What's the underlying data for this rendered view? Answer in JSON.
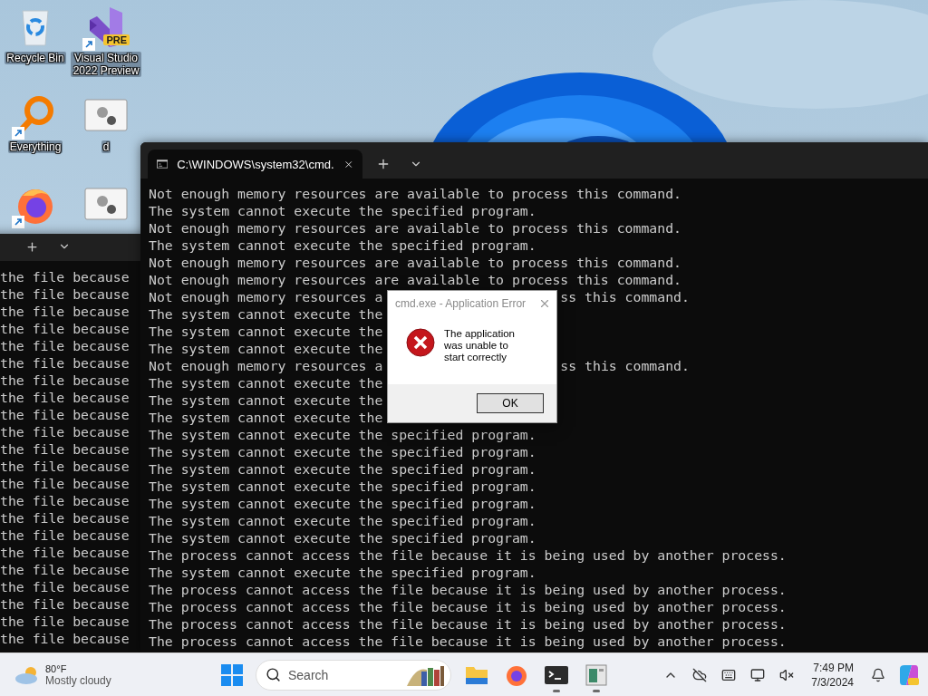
{
  "desktop_icons": [
    {
      "kind": "recycle-bin",
      "label": "Recycle Bin",
      "shortcut": false
    },
    {
      "kind": "everything",
      "label": "Everything",
      "shortcut": true
    },
    {
      "kind": "firefox",
      "shortcut": true
    },
    {
      "kind": "visual-studio",
      "label": "Visual Studio 2022 Preview",
      "badge": "PRE",
      "shortcut": true
    },
    {
      "kind": "settings-app",
      "label": "d",
      "shortcut": false
    },
    {
      "kind": "settings-app",
      "shortcut": false
    }
  ],
  "back_terminal": {
    "lines": [
      "the file because",
      "the file because",
      "the file because",
      "the file because",
      "the file because",
      "the file because",
      "the file because",
      "the file because",
      "the file because",
      "the file because",
      "the file because",
      "the file because",
      "the file because",
      "the file because",
      "the file because",
      "the file because",
      "the file because",
      "the file because",
      "the file because",
      "the file because",
      "the file because",
      "the file because"
    ]
  },
  "front_terminal": {
    "tab": {
      "title": "C:\\WINDOWS\\system32\\cmd.",
      "selected": true
    },
    "lines": [
      {
        "kind": "full",
        "text": "Not enough memory resources are available to process this command."
      },
      {
        "kind": "full",
        "text": "The system cannot execute the specified program."
      },
      {
        "kind": "full",
        "text": "Not enough memory resources are available to process this command."
      },
      {
        "kind": "full",
        "text": "The system cannot execute the specified program."
      },
      {
        "kind": "full",
        "text": "Not enough memory resources are available to process this command."
      },
      {
        "kind": "full",
        "text": "Not enough memory resources are available to process this command."
      },
      {
        "kind": "split",
        "left": "Not enough memory resources a",
        "right": "ss this command."
      },
      {
        "kind": "split",
        "left": "The system cannot execute the"
      },
      {
        "kind": "split",
        "left": "The system cannot execute the"
      },
      {
        "kind": "split",
        "left": "The system cannot execute the"
      },
      {
        "kind": "split",
        "left": "Not enough memory resources a",
        "right": "ss this command."
      },
      {
        "kind": "split",
        "left": "The system cannot execute the"
      },
      {
        "kind": "split",
        "left": "The system cannot execute the"
      },
      {
        "kind": "split",
        "left": "The system cannot execute the"
      },
      {
        "kind": "full",
        "text": "The system cannot execute the specified program."
      },
      {
        "kind": "full",
        "text": "The system cannot execute the specified program."
      },
      {
        "kind": "full",
        "text": "The system cannot execute the specified program."
      },
      {
        "kind": "full",
        "text": "The system cannot execute the specified program."
      },
      {
        "kind": "full",
        "text": "The system cannot execute the specified program."
      },
      {
        "kind": "full",
        "text": "The system cannot execute the specified program."
      },
      {
        "kind": "full",
        "text": "The system cannot execute the specified program."
      },
      {
        "kind": "full",
        "text": "The process cannot access the file because it is being used by another process."
      },
      {
        "kind": "full",
        "text": "The system cannot execute the specified program."
      },
      {
        "kind": "full",
        "text": "The process cannot access the file because it is being used by another process."
      },
      {
        "kind": "full",
        "text": "The process cannot access the file because it is being used by another process."
      },
      {
        "kind": "full",
        "text": "The process cannot access the file because it is being used by another process."
      },
      {
        "kind": "full",
        "text": "The process cannot access the file because it is being used by another process."
      }
    ]
  },
  "dialog": {
    "title": "cmd.exe - Application Error",
    "message": "The application was unable to start correctly",
    "button": "OK"
  },
  "taskbar": {
    "weather": {
      "temperature": "80°F",
      "condition": "Mostly cloudy"
    },
    "search": {
      "placeholder": "Search"
    },
    "apps": [
      {
        "kind": "file-explorer",
        "running": false
      },
      {
        "kind": "firefox",
        "running": false
      },
      {
        "kind": "terminal",
        "running": true
      },
      {
        "kind": "app-window",
        "running": true
      }
    ],
    "clock": {
      "time": "7:49 PM",
      "date": "7/3/2024"
    }
  }
}
